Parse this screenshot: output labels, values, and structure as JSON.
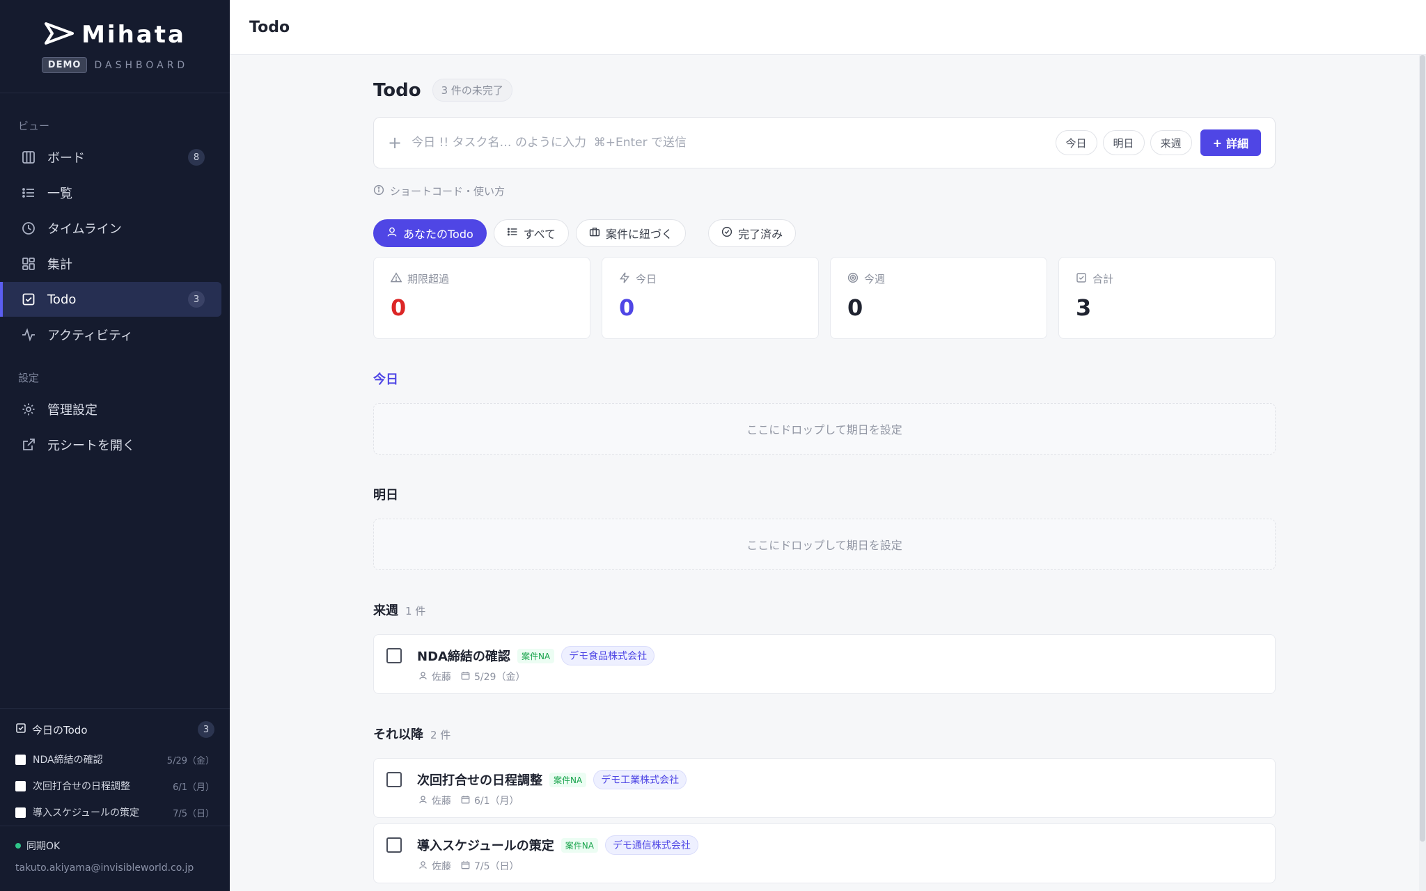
{
  "brand": {
    "name": "Mihata",
    "badge": "DEMO",
    "subtitle": "DASHBOARD"
  },
  "sidebar": {
    "view_label": "ビュー",
    "settings_label": "設定",
    "items": [
      {
        "label": "ボード",
        "badge": "8",
        "icon": "board-icon"
      },
      {
        "label": "一覧",
        "icon": "list-icon"
      },
      {
        "label": "タイムライン",
        "icon": "clock-icon"
      },
      {
        "label": "集計",
        "icon": "grid-icon"
      },
      {
        "label": "Todo",
        "badge": "3",
        "icon": "check-square-icon",
        "active": true
      },
      {
        "label": "アクティビティ",
        "icon": "activity-icon"
      }
    ],
    "settings_items": [
      {
        "label": "管理設定",
        "icon": "gear-icon"
      },
      {
        "label": "元シートを開く",
        "icon": "external-link-icon"
      }
    ],
    "today_todo": {
      "title": "今日のTodo",
      "count": "3",
      "items": [
        {
          "title": "NDA締結の確認",
          "date": "5/29（金）"
        },
        {
          "title": "次回打合せの日程調整",
          "date": "6/1（月）"
        },
        {
          "title": "導入スケジュールの策定",
          "date": "7/5（日）"
        }
      ]
    },
    "footer": {
      "sync": "同期OK",
      "email": "takuto.akiyama@invisibleworld.co.jp"
    }
  },
  "header": {
    "title": "Todo"
  },
  "main": {
    "title": "Todo",
    "incomplete": "3 件の未完了",
    "quick_add": {
      "placeholder": "今日 !! タスク名… のように入力  ⌘+Enter で送信",
      "chips": [
        "今日",
        "明日",
        "来週"
      ],
      "detail_button": "詳細"
    },
    "shortcut_help": "ショートコード・使い方",
    "filters": [
      "あなたのTodo",
      "すべて",
      "案件に紐づく",
      "完了済み"
    ],
    "stats": [
      {
        "label": "期限超過",
        "value": "0",
        "color": "#dc2626"
      },
      {
        "label": "今日",
        "value": "0",
        "color": "#4f46e5"
      },
      {
        "label": "今週",
        "value": "0",
        "color": "#1f2330"
      },
      {
        "label": "合計",
        "value": "3",
        "color": "#1f2330"
      }
    ],
    "groups": {
      "today": {
        "title": "今日",
        "drop": "ここにドロップして期日を設定"
      },
      "tomorrow": {
        "title": "明日",
        "drop": "ここにドロップして期日を設定"
      },
      "next_week": {
        "title": "来週",
        "count": "1 件",
        "tasks": [
          {
            "title": "NDA締結の確認",
            "case_tag": "案件NA",
            "company": "デモ食品株式会社",
            "assignee": "佐藤",
            "date": "5/29（金）"
          }
        ]
      },
      "later": {
        "title": "それ以降",
        "count": "2 件",
        "tasks": [
          {
            "title": "次回打合せの日程調整",
            "case_tag": "案件NA",
            "company": "デモ工業株式会社",
            "assignee": "佐藤",
            "date": "6/1（月）"
          },
          {
            "title": "導入スケジュールの策定",
            "case_tag": "案件NA",
            "company": "デモ通信株式会社",
            "assignee": "佐藤",
            "date": "7/5（日）"
          }
        ]
      }
    }
  }
}
